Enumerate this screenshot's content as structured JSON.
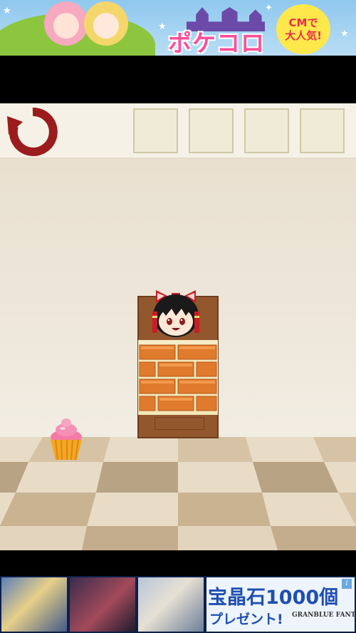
{
  "ads": {
    "top": {
      "title": "ポケコロ",
      "bubble_line1": "CMで",
      "bubble_line2": "大人気!"
    },
    "bottom": {
      "promo_line1": "宝晶石1000個",
      "promo_line2": "プレゼント!",
      "brand": "GRANBLUE FANTASY",
      "info_icon": "i"
    }
  },
  "toolbar": {
    "reset_icon": "reset-arrow-icon",
    "inventory_slots": [
      "",
      "",
      "",
      ""
    ]
  },
  "scene": {
    "door": "wooden-door",
    "bricks": "brick-barrier",
    "character": "reimu-yukkuri-head",
    "item": "pink-cupcake"
  },
  "colors": {
    "wall": "#ece4d6",
    "toolbar": "#f6f1e6",
    "slot": "#efebd6",
    "brick": "#e07a2c",
    "door": "#93572e",
    "reset_icon": "#9b1c1c"
  }
}
